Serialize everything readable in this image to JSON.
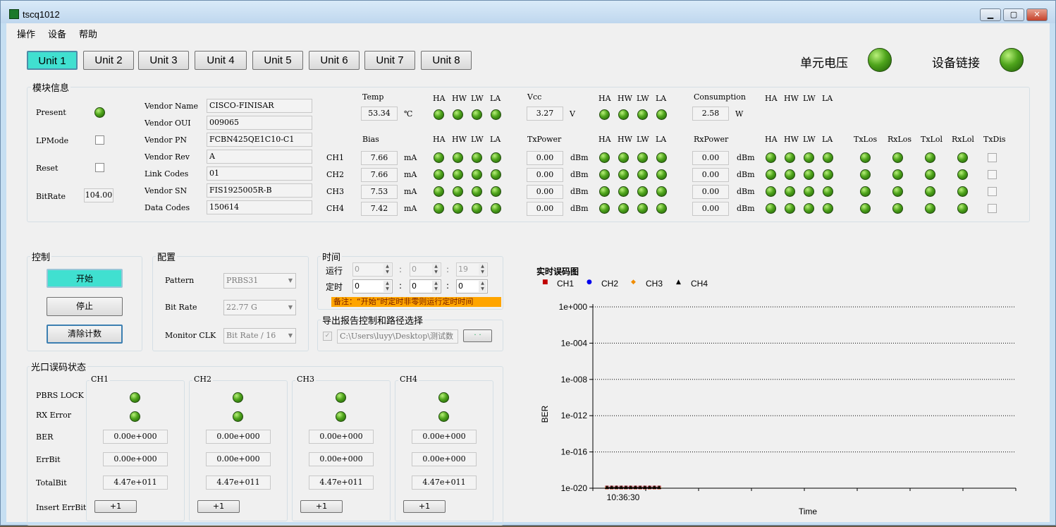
{
  "window": {
    "title": "tscq1012",
    "min": "▁",
    "max": "▢",
    "close": "✕"
  },
  "menu": [
    "操作",
    "设备",
    "帮助"
  ],
  "tabs": [
    "Unit 1",
    "Unit 2",
    "Unit 3",
    "Unit 4",
    "Unit 5",
    "Unit 6",
    "Unit 7",
    "Unit 8"
  ],
  "status": {
    "voltage_label": "单元电压",
    "link_label": "设备链接"
  },
  "module": {
    "title": "模块信息",
    "present": "Present",
    "lpmode": "LPMode",
    "reset": "Reset",
    "bitrate_label": "BitRate",
    "bitrate_value": "104.00",
    "vendor_fields": [
      {
        "label": "Vendor Name",
        "value": "CISCO-FINISAR"
      },
      {
        "label": "Vendor OUI",
        "value": "009065"
      },
      {
        "label": "Vendor PN",
        "value": "FCBN425QE1C10-C1"
      },
      {
        "label": "Vendor Rev",
        "value": "A"
      },
      {
        "label": "Link Codes",
        "value": "01"
      },
      {
        "label": "Vendor SN",
        "value": "FIS1925005R-B"
      },
      {
        "label": "Data Codes",
        "value": "150614"
      }
    ],
    "temp_label": "Temp",
    "temp_value": "53.34",
    "temp_unit": "℃",
    "vcc_label": "Vcc",
    "vcc_value": "3.27",
    "vcc_unit": "V",
    "cons_label": "Consumption",
    "cons_value": "2.58",
    "cons_unit": "W",
    "alarm_labels": [
      "HA",
      "HW",
      "LW",
      "LA"
    ],
    "bias_label": "Bias",
    "txp_label": "TxPower",
    "rxp_label": "RxPower",
    "extra_labels": [
      "TxLos",
      "RxLos",
      "TxLol",
      "RxLol",
      "TxDis"
    ],
    "channels": [
      {
        "ch": "CH1",
        "bias": "7.66",
        "txp": "0.00",
        "rxp": "0.00"
      },
      {
        "ch": "CH2",
        "bias": "7.66",
        "txp": "0.00",
        "rxp": "0.00"
      },
      {
        "ch": "CH3",
        "bias": "7.53",
        "txp": "0.00",
        "rxp": "0.00"
      },
      {
        "ch": "CH4",
        "bias": "7.42",
        "txp": "0.00",
        "rxp": "0.00"
      }
    ],
    "unit_ma": "mA",
    "unit_dbm": "dBm"
  },
  "control": {
    "title": "控制",
    "start": "开始",
    "stop": "停止",
    "clear": "清除计数"
  },
  "config": {
    "title": "配置",
    "pattern_label": "Pattern",
    "pattern_value": "PRBS31",
    "bitrate_label": "Bit Rate",
    "bitrate_value": "22.77 G",
    "clk_label": "Monitor CLK",
    "clk_value": "Bit Rate / 16"
  },
  "time": {
    "title": "时间",
    "run_label": "运行",
    "run": [
      "0",
      "0",
      "19"
    ],
    "timer_label": "定时",
    "timer": [
      "0",
      "0",
      "0"
    ],
    "sep": ":",
    "note": "备注：“开始”时定时非零则运行定时时间"
  },
  "export": {
    "title": "导出报告控制和路径选择",
    "path": "C:\\Users\\luyy\\Desktop\\测试数",
    "browse": "· ·"
  },
  "port": {
    "title": "光口误码状态",
    "row_labels": [
      "PBRS LOCK",
      "RX Error",
      "BER",
      "ErrBit",
      "TotalBit",
      "Insert ErrBit"
    ],
    "channels": [
      {
        "name": "CH1",
        "ber": "0.00e+000",
        "errbit": "0.00e+000",
        "total": "4.47e+011",
        "insert": "+1"
      },
      {
        "name": "CH2",
        "ber": "0.00e+000",
        "errbit": "0.00e+000",
        "total": "4.47e+011",
        "insert": "+1"
      },
      {
        "name": "CH3",
        "ber": "0.00e+000",
        "errbit": "0.00e+000",
        "total": "4.47e+011",
        "insert": "+1"
      },
      {
        "name": "CH4",
        "ber": "0.00e+000",
        "errbit": "0.00e+000",
        "total": "4.47e+011",
        "insert": "+1"
      }
    ]
  },
  "chart_data": {
    "type": "scatter",
    "title": "实时误码图",
    "xlabel": "Time",
    "ylabel": "BER",
    "yscale": "log",
    "ylim": [
      1e-20,
      1
    ],
    "yticks": [
      "1e+000",
      "1e-004",
      "1e-008",
      "1e-012",
      "1e-016",
      "1e-020"
    ],
    "xticks": [
      "10:36:30"
    ],
    "grid": "horizontal dotted",
    "legend_position": "top-left",
    "series": [
      {
        "name": "CH1",
        "marker": "square",
        "color": "#c00000",
        "y": [
          1e-20,
          1e-20,
          1e-20,
          1e-20,
          1e-20,
          1e-20,
          1e-20,
          1e-20,
          1e-20,
          1e-20,
          1e-20,
          1e-20
        ]
      },
      {
        "name": "CH2",
        "marker": "circle",
        "color": "#0000ee",
        "y": [
          1e-20,
          1e-20,
          1e-20,
          1e-20,
          1e-20,
          1e-20,
          1e-20,
          1e-20,
          1e-20,
          1e-20,
          1e-20,
          1e-20
        ]
      },
      {
        "name": "CH3",
        "marker": "diamond",
        "color": "#f08c00",
        "y": [
          1e-20,
          1e-20,
          1e-20,
          1e-20,
          1e-20,
          1e-20,
          1e-20,
          1e-20,
          1e-20,
          1e-20,
          1e-20,
          1e-20
        ]
      },
      {
        "name": "CH4",
        "marker": "triangle",
        "color": "#000000",
        "y": [
          1e-20,
          1e-20,
          1e-20,
          1e-20,
          1e-20,
          1e-20,
          1e-20,
          1e-20,
          1e-20,
          1e-20,
          1e-20,
          1e-20
        ]
      }
    ]
  }
}
